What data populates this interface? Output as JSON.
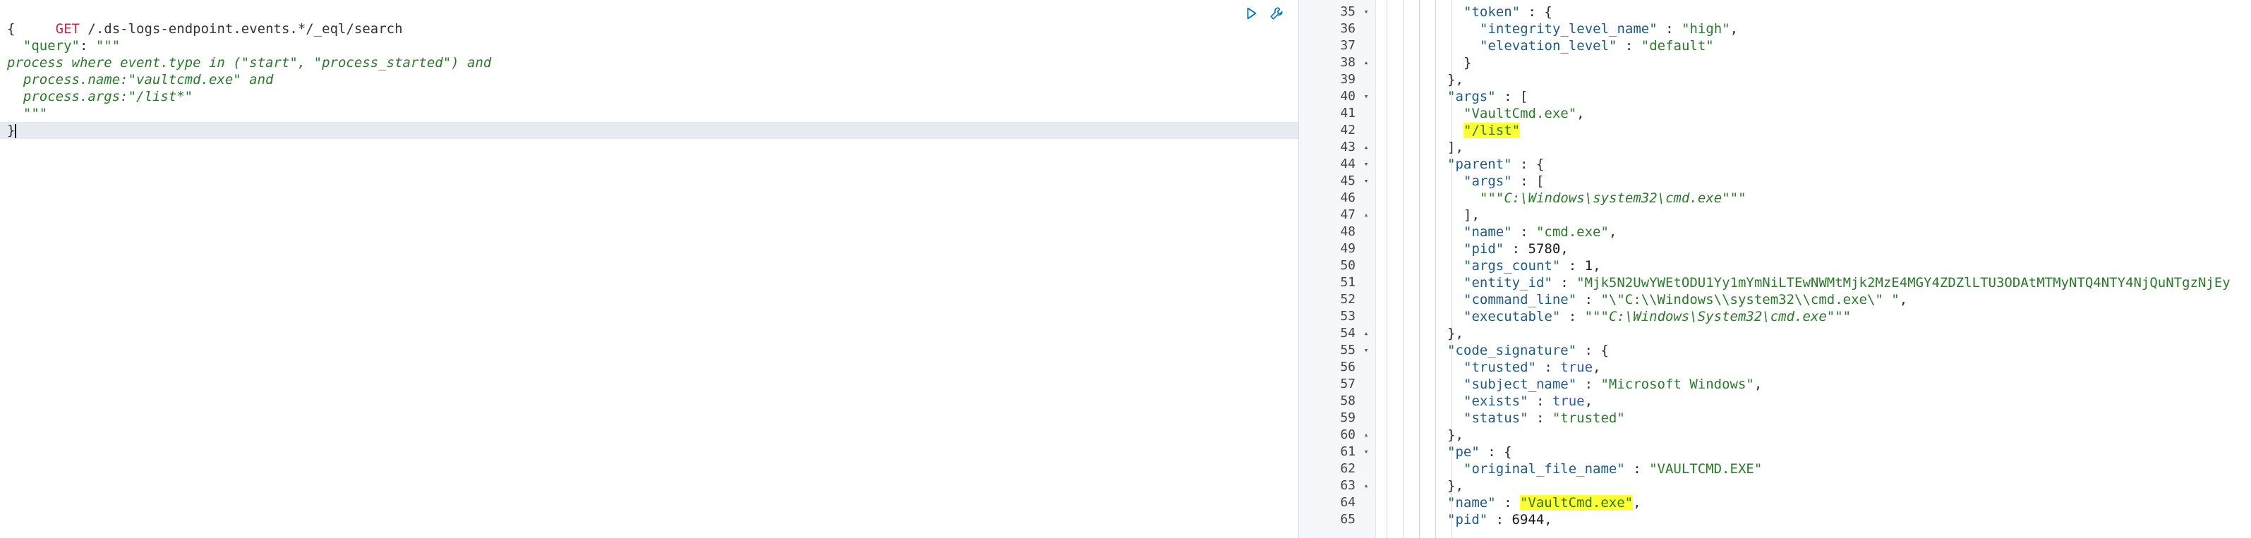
{
  "request": {
    "method": "GET",
    "endpoint": "/.ds-logs-endpoint.events.*/_eql/search",
    "body": {
      "open_brace": "{",
      "query_key": "\"query\"",
      "query_sep": ": ",
      "triple_quote": "\"\"\"",
      "eql_lines": [
        "process where event.type in (\"start\", \"process_started\") and",
        "  process.name:\"vaultcmd.exe\" and",
        "  process.args:\"/list*\""
      ],
      "close_triple_quote": "  \"\"\"",
      "close_brace": "}"
    },
    "actions": [
      {
        "name": "play-icon",
        "label": "Run request"
      },
      {
        "name": "wrench-icon",
        "label": "Settings"
      }
    ]
  },
  "response": {
    "lines": [
      {
        "n": "35",
        "fold": "▾",
        "indent": 5,
        "parts": [
          {
            "t": "\"token\"",
            "c": "rk"
          },
          {
            "t": " : {",
            "c": "rp"
          }
        ]
      },
      {
        "n": "36",
        "fold": "",
        "indent": 6,
        "parts": [
          {
            "t": "\"integrity_level_name\"",
            "c": "rk"
          },
          {
            "t": " : ",
            "c": "rp"
          },
          {
            "t": "\"high\"",
            "c": "rs"
          },
          {
            "t": ",",
            "c": "rp"
          }
        ]
      },
      {
        "n": "37",
        "fold": "",
        "indent": 6,
        "parts": [
          {
            "t": "\"elevation_level\"",
            "c": "rk"
          },
          {
            "t": " : ",
            "c": "rp"
          },
          {
            "t": "\"default\"",
            "c": "rs"
          }
        ]
      },
      {
        "n": "38",
        "fold": "▴",
        "indent": 5,
        "parts": [
          {
            "t": "}",
            "c": "rp"
          }
        ]
      },
      {
        "n": "39",
        "fold": "",
        "indent": 4,
        "parts": [
          {
            "t": "},",
            "c": "rp"
          }
        ]
      },
      {
        "n": "40",
        "fold": "▾",
        "indent": 4,
        "parts": [
          {
            "t": "\"args\"",
            "c": "rk"
          },
          {
            "t": " : [",
            "c": "rp"
          }
        ]
      },
      {
        "n": "41",
        "fold": "",
        "indent": 5,
        "parts": [
          {
            "t": "\"VaultCmd.exe\"",
            "c": "rs"
          },
          {
            "t": ",",
            "c": "rp"
          }
        ]
      },
      {
        "n": "42",
        "fold": "",
        "indent": 5,
        "parts": [
          {
            "t": "\"/list\"",
            "c": "rs",
            "hl": true
          }
        ]
      },
      {
        "n": "43",
        "fold": "▴",
        "indent": 4,
        "parts": [
          {
            "t": "],",
            "c": "rp"
          }
        ]
      },
      {
        "n": "44",
        "fold": "▾",
        "indent": 4,
        "parts": [
          {
            "t": "\"parent\"",
            "c": "rk"
          },
          {
            "t": " : {",
            "c": "rp"
          }
        ]
      },
      {
        "n": "45",
        "fold": "▾",
        "indent": 5,
        "parts": [
          {
            "t": "\"args\"",
            "c": "rk"
          },
          {
            "t": " : [",
            "c": "rp"
          }
        ]
      },
      {
        "n": "46",
        "fold": "",
        "indent": 6,
        "parts": [
          {
            "t": "\"\"\"",
            "c": "rs"
          },
          {
            "t": "C:\\Windows\\system32\\cmd.exe",
            "c": "rsi"
          },
          {
            "t": "\"\"\"",
            "c": "rs"
          }
        ]
      },
      {
        "n": "47",
        "fold": "▴",
        "indent": 5,
        "parts": [
          {
            "t": "],",
            "c": "rp"
          }
        ]
      },
      {
        "n": "48",
        "fold": "",
        "indent": 5,
        "parts": [
          {
            "t": "\"name\"",
            "c": "rk"
          },
          {
            "t": " : ",
            "c": "rp"
          },
          {
            "t": "\"cmd.exe\"",
            "c": "rs"
          },
          {
            "t": ",",
            "c": "rp"
          }
        ]
      },
      {
        "n": "49",
        "fold": "",
        "indent": 5,
        "parts": [
          {
            "t": "\"pid\"",
            "c": "rk"
          },
          {
            "t": " : ",
            "c": "rp"
          },
          {
            "t": "5780",
            "c": "rn"
          },
          {
            "t": ",",
            "c": "rp"
          }
        ]
      },
      {
        "n": "50",
        "fold": "",
        "indent": 5,
        "parts": [
          {
            "t": "\"args_count\"",
            "c": "rk"
          },
          {
            "t": " : ",
            "c": "rp"
          },
          {
            "t": "1",
            "c": "rn"
          },
          {
            "t": ",",
            "c": "rp"
          }
        ]
      },
      {
        "n": "51",
        "fold": "",
        "indent": 5,
        "parts": [
          {
            "t": "\"entity_id\"",
            "c": "rk"
          },
          {
            "t": " : ",
            "c": "rp"
          },
          {
            "t": "\"Mjk5N2UwYWEtODU1Yy1mYmNiLTEwNWMtMjk2MzE4MGY4ZDZlLTU3ODAtMTMyNTQ4NTY4NjQuNTgzNjEy",
            "c": "rs"
          }
        ]
      },
      {
        "n": "52",
        "fold": "",
        "indent": 5,
        "parts": [
          {
            "t": "\"command_line\"",
            "c": "rk"
          },
          {
            "t": " : ",
            "c": "rp"
          },
          {
            "t": "\"\\\"C:\\\\Windows\\\\system32\\\\cmd.exe\\\" \"",
            "c": "rs"
          },
          {
            "t": ",",
            "c": "rp"
          }
        ]
      },
      {
        "n": "53",
        "fold": "",
        "indent": 5,
        "parts": [
          {
            "t": "\"executable\"",
            "c": "rk"
          },
          {
            "t": " : ",
            "c": "rp"
          },
          {
            "t": "\"\"\"",
            "c": "rs"
          },
          {
            "t": "C:\\Windows\\System32\\cmd.exe",
            "c": "rsi"
          },
          {
            "t": "\"\"\"",
            "c": "rs"
          }
        ]
      },
      {
        "n": "54",
        "fold": "▴",
        "indent": 4,
        "parts": [
          {
            "t": "},",
            "c": "rp"
          }
        ]
      },
      {
        "n": "55",
        "fold": "▾",
        "indent": 4,
        "parts": [
          {
            "t": "\"code_signature\"",
            "c": "rk"
          },
          {
            "t": " : {",
            "c": "rp"
          }
        ]
      },
      {
        "n": "56",
        "fold": "",
        "indent": 5,
        "parts": [
          {
            "t": "\"trusted\"",
            "c": "rk"
          },
          {
            "t": " : ",
            "c": "rp"
          },
          {
            "t": "true",
            "c": "rb"
          },
          {
            "t": ",",
            "c": "rp"
          }
        ]
      },
      {
        "n": "57",
        "fold": "",
        "indent": 5,
        "parts": [
          {
            "t": "\"subject_name\"",
            "c": "rk"
          },
          {
            "t": " : ",
            "c": "rp"
          },
          {
            "t": "\"Microsoft Windows\"",
            "c": "rs"
          },
          {
            "t": ",",
            "c": "rp"
          }
        ]
      },
      {
        "n": "58",
        "fold": "",
        "indent": 5,
        "parts": [
          {
            "t": "\"exists\"",
            "c": "rk"
          },
          {
            "t": " : ",
            "c": "rp"
          },
          {
            "t": "true",
            "c": "rb"
          },
          {
            "t": ",",
            "c": "rp"
          }
        ]
      },
      {
        "n": "59",
        "fold": "",
        "indent": 5,
        "parts": [
          {
            "t": "\"status\"",
            "c": "rk"
          },
          {
            "t": " : ",
            "c": "rp"
          },
          {
            "t": "\"trusted\"",
            "c": "rs"
          }
        ]
      },
      {
        "n": "60",
        "fold": "▴",
        "indent": 4,
        "parts": [
          {
            "t": "},",
            "c": "rp"
          }
        ]
      },
      {
        "n": "61",
        "fold": "▾",
        "indent": 4,
        "parts": [
          {
            "t": "\"pe\"",
            "c": "rk"
          },
          {
            "t": " : {",
            "c": "rp"
          }
        ]
      },
      {
        "n": "62",
        "fold": "",
        "indent": 5,
        "parts": [
          {
            "t": "\"original_file_name\"",
            "c": "rk"
          },
          {
            "t": " : ",
            "c": "rp"
          },
          {
            "t": "\"VAULTCMD.EXE\"",
            "c": "rs"
          }
        ]
      },
      {
        "n": "63",
        "fold": "▴",
        "indent": 4,
        "parts": [
          {
            "t": "},",
            "c": "rp"
          }
        ]
      },
      {
        "n": "64",
        "fold": "",
        "indent": 4,
        "parts": [
          {
            "t": "\"name\"",
            "c": "rk"
          },
          {
            "t": " : ",
            "c": "rp"
          },
          {
            "t": "\"VaultCmd.exe\"",
            "c": "rs",
            "hl": true
          },
          {
            "t": ",",
            "c": "rp"
          }
        ]
      },
      {
        "n": "65",
        "fold": "",
        "indent": 4,
        "parts": [
          {
            "t": "\"pid\"",
            "c": "rk"
          },
          {
            "t": " : ",
            "c": "rp"
          },
          {
            "t": "6944",
            "c": "rn"
          },
          {
            "t": ",",
            "c": "rp"
          }
        ]
      }
    ]
  }
}
